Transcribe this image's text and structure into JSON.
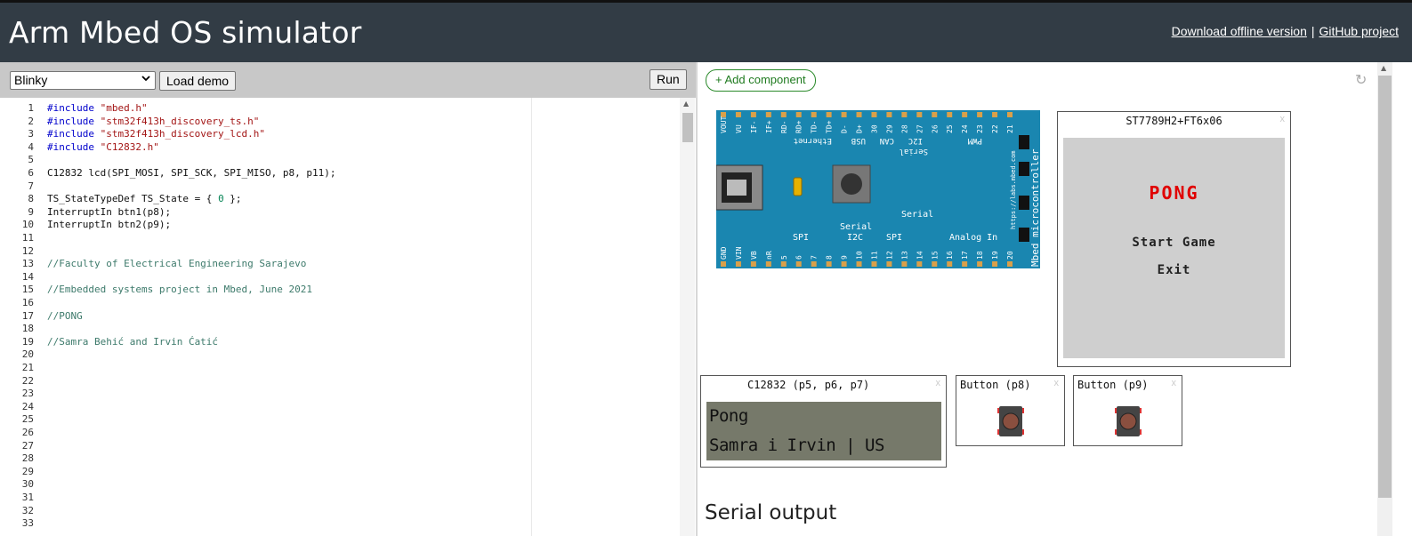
{
  "header": {
    "title": "Arm Mbed OS simulator",
    "link_offline": "Download offline version",
    "separator": "|",
    "link_github": "GitHub project"
  },
  "toolbar": {
    "demo_selected": "Blinky",
    "load_label": "Load demo",
    "run_label": "Run"
  },
  "editor": {
    "lines": [
      {
        "n": "1",
        "kw": "#include",
        "str": " \"mbed.h\""
      },
      {
        "n": "2",
        "kw": "#include",
        "str": " \"stm32f413h_discovery_ts.h\""
      },
      {
        "n": "3",
        "kw": "#include",
        "str": " \"stm32f413h_discovery_lcd.h\""
      },
      {
        "n": "4",
        "kw": "#include",
        "str": " \"C12832.h\""
      },
      {
        "n": "5"
      },
      {
        "n": "6",
        "txt": "C12832 lcd(SPI_MOSI, SPI_SCK, SPI_MISO, p8, p11);"
      },
      {
        "n": "7"
      },
      {
        "n": "8",
        "txt": "TS_StateTypeDef TS_State = { ",
        "num": "0",
        "txt2": " };"
      },
      {
        "n": "9",
        "txt": "InterruptIn btn1(p8);"
      },
      {
        "n": "10",
        "txt": "InterruptIn btn2(p9);"
      },
      {
        "n": "11"
      },
      {
        "n": "12"
      },
      {
        "n": "13",
        "com": "//Faculty of Electrical Engineering Sarajevo"
      },
      {
        "n": "14"
      },
      {
        "n": "15",
        "com": "//Embedded systems project in Mbed, June 2021"
      },
      {
        "n": "16"
      },
      {
        "n": "17",
        "com": "//PONG"
      },
      {
        "n": "18"
      },
      {
        "n": "19",
        "com": "//Samra Behić and Irvin Ćatić"
      },
      {
        "n": "20"
      },
      {
        "n": "21"
      },
      {
        "n": "22"
      },
      {
        "n": "23"
      },
      {
        "n": "24"
      },
      {
        "n": "25"
      },
      {
        "n": "26"
      },
      {
        "n": "27"
      },
      {
        "n": "28"
      },
      {
        "n": "29"
      },
      {
        "n": "30"
      },
      {
        "n": "31"
      },
      {
        "n": "32"
      },
      {
        "n": "33"
      }
    ]
  },
  "right": {
    "add_component_label": "+ Add component",
    "refresh_icon": "↻",
    "tft": {
      "title": "ST7789H2+FT6x06",
      "close": "x",
      "game_title": "PONG",
      "menu": [
        "Start Game",
        "Exit"
      ]
    },
    "lcd": {
      "title": "C12832 (p5, p6, p7)",
      "close": "x",
      "line1": "Pong",
      "line2": "Samra i Irvin | US"
    },
    "buttons": [
      {
        "title": "Button (p8)",
        "close": "x"
      },
      {
        "title": "Button (p9)",
        "close": "x"
      }
    ],
    "serial_output_label": "Serial output"
  },
  "board": {
    "url_text": "https://labs.mbed.com",
    "brand": "Mbed microcontroller",
    "top_pins": [
      "VOUT",
      "VU",
      "IF-",
      "IF+",
      "RD-",
      "RD+",
      "TD-",
      "TD+",
      "D-",
      "D+",
      "30",
      "29",
      "28",
      "27",
      "26",
      "25",
      "24",
      "23",
      "22",
      "21"
    ],
    "bottom_pins": [
      "GND",
      "VIN",
      "VB",
      "nR",
      "5",
      "6",
      "7",
      "8",
      "9",
      "10",
      "11",
      "12",
      "13",
      "14",
      "15",
      "16",
      "17",
      "18",
      "19",
      "20"
    ],
    "top_labels": [
      "Ethernet",
      "USB",
      "CAN",
      "I2C",
      "PWM",
      "Serial"
    ],
    "bottom_labels": [
      "SPI",
      "I2C",
      "SPI",
      "Analog In",
      "Serial",
      "Serial"
    ],
    "colors": {
      "board": "#1a86b0",
      "pads": "#d9a04a"
    }
  }
}
